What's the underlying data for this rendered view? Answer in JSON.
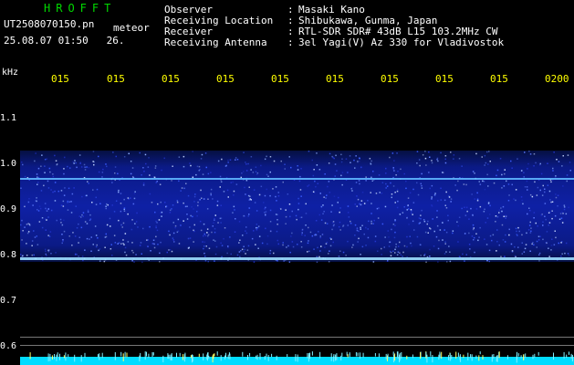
{
  "header": {
    "app_title": "HROFFT",
    "filename": "UT2508070150.pn",
    "filename_suffix": "meteor",
    "datetime": "25.08.07 01:50",
    "datetime_extra": "26.",
    "info": [
      {
        "label": "Observer",
        "value": "Masaki Kano"
      },
      {
        "label": "Receiving Location",
        "value": "Shibukawa, Gunma, Japan"
      },
      {
        "label": "Receiver",
        "value": "RTL-SDR SDR# 43dB L15 103.2MHz CW"
      },
      {
        "label": "Receiving Antenna",
        "value": "3el Yagi(V) Az 330 for Vladivostok"
      }
    ],
    "separator": ":"
  },
  "axes": {
    "unit_label": "kHz",
    "x_ticks": [
      "015",
      "015",
      "015",
      "015",
      "015",
      "015",
      "015",
      "015",
      "015",
      "0200"
    ],
    "y_ticks": [
      "1.1",
      "1.0",
      "0.9",
      "0.8",
      "0.7",
      "0.6"
    ]
  },
  "colors": {
    "background": "#000000",
    "title": "#00d800",
    "text": "#ffffff",
    "tick": "#ffff00",
    "signal_band": "#1a2cff",
    "signal_line": "#66ccff",
    "baseline": "#00e5ff"
  }
}
